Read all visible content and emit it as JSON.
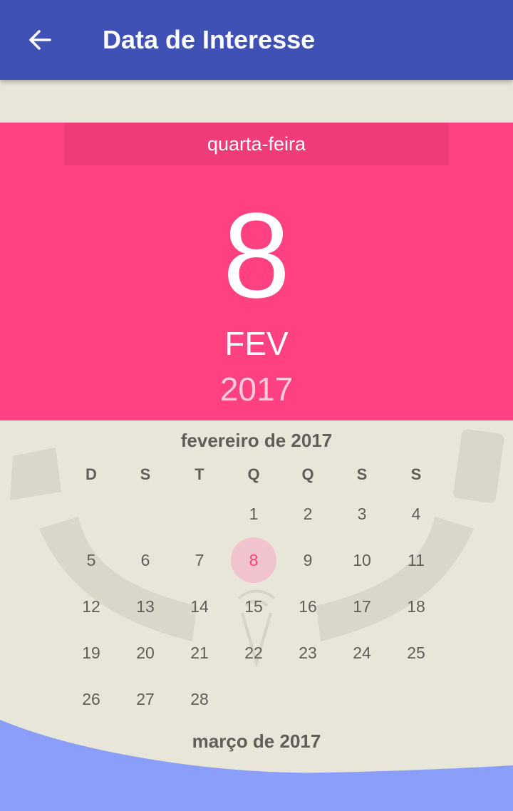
{
  "app_bar": {
    "title": "Data de Interesse",
    "back_icon": "arrow-back-icon",
    "color": "#3f51b5"
  },
  "picker_header": {
    "weekday": "quarta-feira",
    "day": "8",
    "month": "FEV",
    "year": "2017",
    "color": "#ff4081"
  },
  "calendar": {
    "month_title": "fevereiro de 2017",
    "weekday_headers": [
      "D",
      "S",
      "T",
      "Q",
      "Q",
      "S",
      "S"
    ],
    "first_weekday_index": 3,
    "days": [
      "1",
      "2",
      "3",
      "4",
      "5",
      "6",
      "7",
      "8",
      "9",
      "10",
      "11",
      "12",
      "13",
      "14",
      "15",
      "16",
      "17",
      "18",
      "19",
      "20",
      "21",
      "22",
      "23",
      "24",
      "25",
      "26",
      "27",
      "28"
    ],
    "selected_day": "8",
    "next_month_title": "março de 2017"
  }
}
